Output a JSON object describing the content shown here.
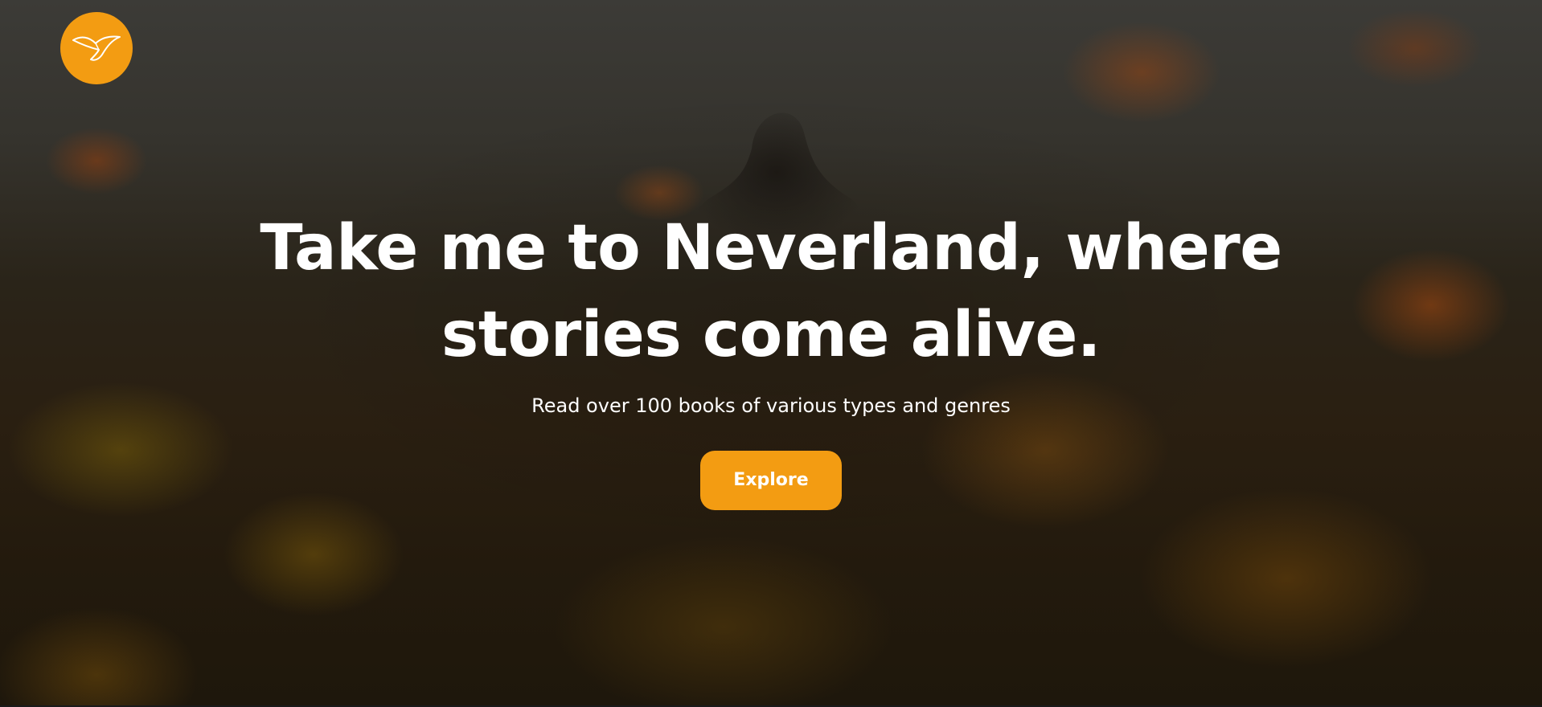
{
  "hero": {
    "headline": "Take me to Neverland, where stories come alive.",
    "subtitle": "Read over 100 books of various types and genres",
    "explore_label": "Explore"
  },
  "logo": {
    "icon": "bird-icon"
  },
  "colors": {
    "accent": "#f39c12",
    "text": "#ffffff",
    "background": "#2a2419"
  }
}
